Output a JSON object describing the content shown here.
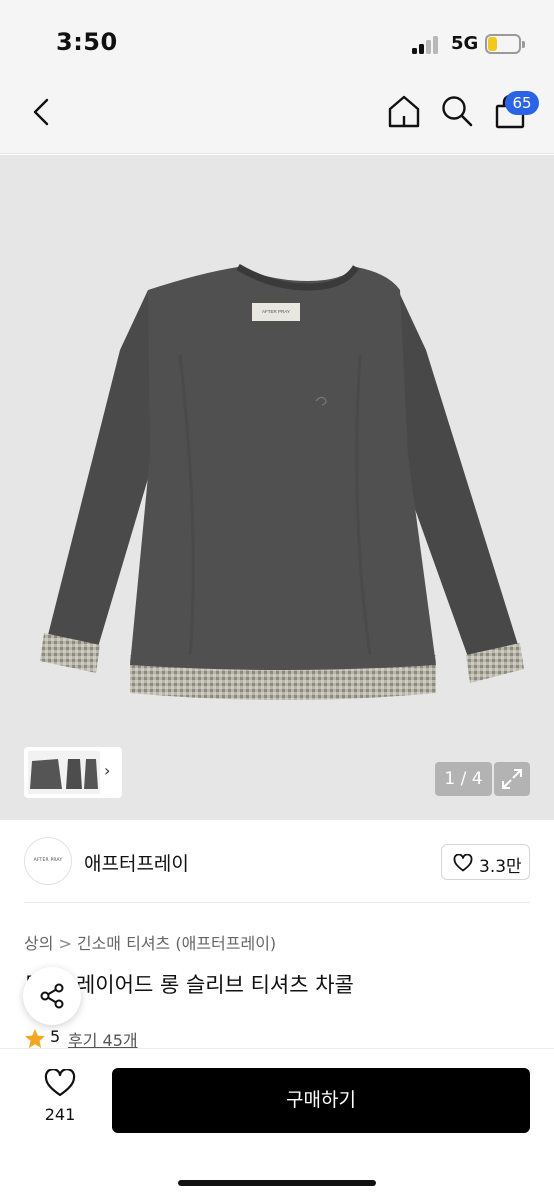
{
  "status_bar": {
    "time": "3:50",
    "network": "5G",
    "battery_level": 0.3,
    "battery_color": "#f3c81d"
  },
  "nav": {
    "back_icon": "chevron-left-icon",
    "home_icon": "home-icon",
    "search_icon": "search-icon",
    "cart_icon": "shopping-bag-icon",
    "cart_count": "65",
    "badge_color": "#2b63e6"
  },
  "gallery": {
    "counter": "1 / 4",
    "current_index": 1,
    "total": 4,
    "image_label": "AFTER PRAY",
    "thumb_arrow": "›",
    "expand_icon": "expand-icon"
  },
  "brand": {
    "logo_text": "AFTER PRAY",
    "name": "애프터프레이",
    "follow_icon": "heart-outline-icon",
    "follow_count": "3.3만"
  },
  "breadcrumb": {
    "items": [
      "상의",
      "긴소매 티셔츠 (애프터프레이)"
    ],
    "separator": ">"
  },
  "product": {
    "title": "투 타 레이어드 롱 슬리브 티셔츠 차콜",
    "rating": "5",
    "review_label": "후기 45개",
    "star_color": "#f5a623"
  },
  "share": {
    "icon": "share-icon"
  },
  "bottom_bar": {
    "like_icon": "heart-outline-icon",
    "like_count": "241",
    "buy_label": "구매하기"
  }
}
